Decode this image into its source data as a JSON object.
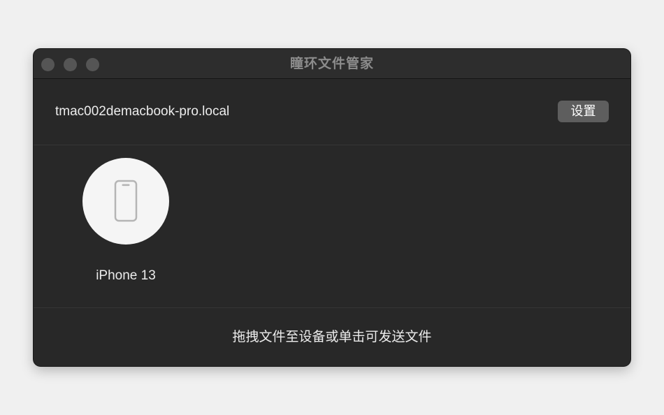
{
  "window": {
    "title": "瞳环文件管家"
  },
  "header": {
    "hostname": "tmac002demacbook-pro.local",
    "settings_label": "设置"
  },
  "devices": [
    {
      "name": "iPhone 13",
      "icon": "smartphone-icon"
    }
  ],
  "footer": {
    "hint": "拖拽文件至设备或单击可发送文件"
  },
  "colors": {
    "page_background": "#f0f0f0",
    "window_background": "#282828",
    "titlebar_background": "#2d2d2d",
    "button_background": "#5e5e5e",
    "text_primary": "#ececec",
    "title_text": "#8c8c8c",
    "avatar_background": "#f5f5f5",
    "icon_stroke": "#b5b5b5"
  }
}
